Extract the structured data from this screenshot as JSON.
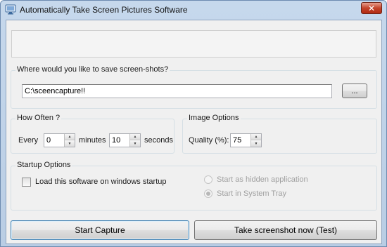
{
  "window": {
    "title": "Automatically Take Screen Pictures Software",
    "close_label": "✕"
  },
  "save": {
    "legend": "Where would you like to save screen-shots?",
    "path_value": "C:\\sceencapture!!",
    "browse_label": "..."
  },
  "how_often": {
    "legend": "How Often ?",
    "every_label": "Every",
    "minutes_value": "0",
    "minutes_label": "minutes",
    "seconds_value": "10",
    "seconds_label": "seconds"
  },
  "image_options": {
    "legend": "Image Options",
    "quality_label": "Quality (%):",
    "quality_value": "75"
  },
  "startup": {
    "legend": "Startup Options",
    "load_on_startup_label": "Load this software on windows startup",
    "load_on_startup_checked": false,
    "hidden_app_label": "Start as hidden application",
    "system_tray_label": "Start in System Tray",
    "selected_option": "Start in System Tray"
  },
  "actions": {
    "start_capture_label": "Start Capture",
    "test_screenshot_label": "Take screenshot now (Test)"
  }
}
